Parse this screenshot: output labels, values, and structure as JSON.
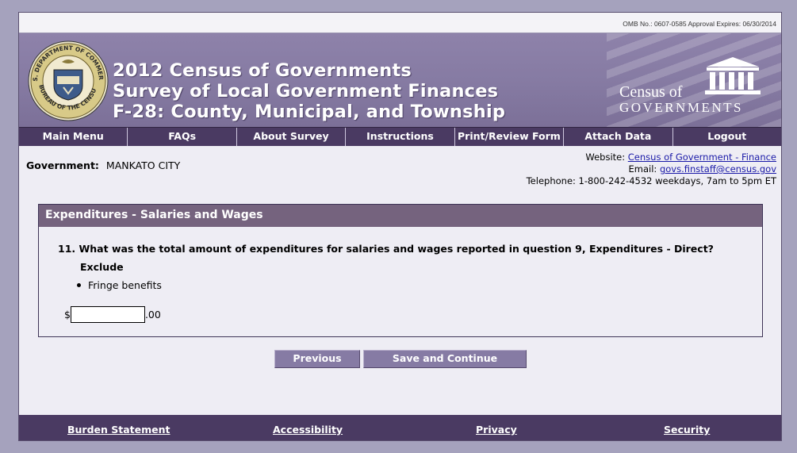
{
  "omb": "OMB No.: 0607-0585 Approval Expires: 06/30/2014",
  "header": {
    "title_lines": [
      "2012 Census of Governments",
      "Survey of Local Government Finances",
      "F-28: County, Municipal, and Township"
    ],
    "logo_line1": "Census of",
    "logo_line2": "GOVERNMENTS",
    "seal_top": "U.S. DEPARTMENT OF COMMERCE",
    "seal_bottom": "BUREAU OF THE CENSUS"
  },
  "nav": [
    "Main Menu",
    "FAQs",
    "About Survey",
    "Instructions",
    "Print/Review Form",
    "Attach Data",
    "Logout"
  ],
  "info": {
    "gov_label": "Government:",
    "gov_value": "MANKATO CITY",
    "website_label": "Website:",
    "website_link": "Census of Government - Finance",
    "email_label": "Email:",
    "email_link": "govs.finstaff@census.gov",
    "telephone": "Telephone: 1-800-242-4532 weekdays, 7am to 5pm ET"
  },
  "panel": {
    "heading": "Expenditures - Salaries and Wages",
    "question": "11. What was the total amount of expenditures for salaries and wages reported in question 9, Expenditures - Direct?",
    "exclude_label": "Exclude",
    "bullet": "Fringe benefits",
    "currency": "$",
    "cents": ".00",
    "amount_value": ""
  },
  "buttons": {
    "previous": "Previous",
    "save": "Save and Continue"
  },
  "footer": [
    "Burden Statement",
    "Accessibility",
    "Privacy",
    "Security"
  ]
}
